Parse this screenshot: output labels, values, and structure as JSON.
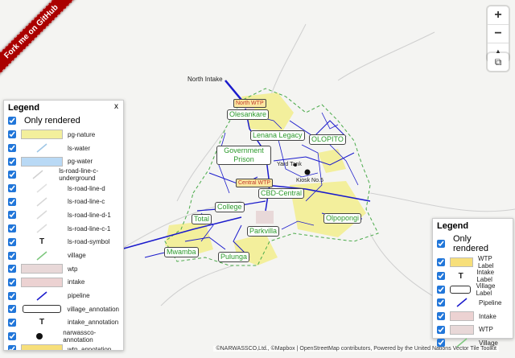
{
  "ribbon": "Fork me on GitHub",
  "controls": {
    "zoom_in": "+",
    "zoom_out": "−",
    "compass": "▲",
    "layers": "⧉"
  },
  "legend1": {
    "title": "Legend",
    "close": "x",
    "only_rendered": "Only rendered",
    "items": [
      {
        "label": "pg-nature",
        "type": "fill",
        "color": "#f3ef9c"
      },
      {
        "label": "ls-water",
        "type": "line",
        "color": "#9ec6e6"
      },
      {
        "label": "pg-water",
        "type": "fill",
        "color": "#b9d9f5"
      },
      {
        "label": "ls-road-line-c-underground",
        "type": "line",
        "color": "#d0d0d0"
      },
      {
        "label": "ls-road-line-d",
        "type": "line",
        "color": "#e0e0e0"
      },
      {
        "label": "ls-road-line-c",
        "type": "line",
        "color": "#d6d6d6"
      },
      {
        "label": "ls-road-line-d-1",
        "type": "line",
        "color": "#d9d9d9"
      },
      {
        "label": "ls-road-line-c-1",
        "type": "line",
        "color": "#dcdcdc"
      },
      {
        "label": "ls-road-symbol",
        "type": "symbol",
        "symbol": "T"
      },
      {
        "label": "village",
        "type": "line",
        "color": "#7dc77d"
      },
      {
        "label": "wtp",
        "type": "fill",
        "color": "#e8d8d8"
      },
      {
        "label": "intake",
        "type": "fill",
        "color": "#ecd2d2"
      },
      {
        "label": "pipeline",
        "type": "line",
        "color": "#1a1acc"
      },
      {
        "label": "village_annotation",
        "type": "box"
      },
      {
        "label": "intake_annotation",
        "type": "symbol",
        "symbol": "T"
      },
      {
        "label": "narwassco-annotation",
        "type": "dot"
      },
      {
        "label": "wtp_annotation",
        "type": "fill",
        "color": "#f7df7a"
      }
    ]
  },
  "legend2": {
    "title": "Legend",
    "close": "",
    "only_rendered": "Only rendered",
    "items": [
      {
        "label": "WTP Label",
        "type": "fill",
        "color": "#f7df7a"
      },
      {
        "label": "Intake Label",
        "type": "symbol",
        "symbol": "T"
      },
      {
        "label": "Village Label",
        "type": "box"
      },
      {
        "label": "Pipeline",
        "type": "line",
        "color": "#1a1acc"
      },
      {
        "label": "Intake",
        "type": "fill",
        "color": "#ecd2d2"
      },
      {
        "label": "WTP",
        "type": "fill",
        "color": "#e8d8d8"
      },
      {
        "label": "Village",
        "type": "line",
        "color": "#7dc77d"
      }
    ]
  },
  "map_labels": {
    "north_intake": "North Intake",
    "north_wtp": "North WTP",
    "central_wtp": "Central WTP",
    "yard_tank": "Yard Tank",
    "kiosk": "Kiosk No.5",
    "villages": [
      "Olesankare",
      "Lenana Legacy",
      "OLOPITO",
      "Government Prison",
      "College",
      "CBD-Central",
      "Total",
      "Parkvilla",
      "Mwamba",
      "Pulunga",
      "Olpopongi"
    ]
  },
  "attribution": "©NARWASSCO,Ltd., ©Mapbox | OpenStreetMap contributors, Powered by the United Nations Vector Tile Toolkit"
}
